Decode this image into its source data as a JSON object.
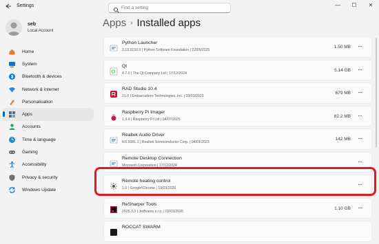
{
  "window": {
    "title": "Settings",
    "controls": [
      "—",
      "☐",
      "✕"
    ]
  },
  "search": {
    "placeholder": "Find a setting"
  },
  "user": {
    "name": "seb",
    "account_type": "Local Account"
  },
  "sidebar": {
    "items": [
      {
        "label": "Home",
        "icon": "home-icon",
        "color": "#e07c36"
      },
      {
        "label": "System",
        "icon": "system-icon",
        "color": "#0a78d4"
      },
      {
        "label": "Bluetooth & devices",
        "icon": "bluetooth-icon",
        "color": "#0a78d4"
      },
      {
        "label": "Network & internet",
        "icon": "network-icon",
        "color": "#3a86d4"
      },
      {
        "label": "Personalisation",
        "icon": "personalisation-icon",
        "color": "#e08b3a"
      },
      {
        "label": "Apps",
        "icon": "apps-icon",
        "color": "#4b6b8f",
        "active": true
      },
      {
        "label": "Accounts",
        "icon": "accounts-icon",
        "color": "#2f9e6a"
      },
      {
        "label": "Time & language",
        "icon": "time-language-icon",
        "color": "#2a83d4"
      },
      {
        "label": "Gaming",
        "icon": "gaming-icon",
        "color": "#6b6b6b"
      },
      {
        "label": "Accessibility",
        "icon": "accessibility-icon",
        "color": "#1c78c8"
      },
      {
        "label": "Privacy & security",
        "icon": "privacy-security-icon",
        "color": "#707070"
      },
      {
        "label": "Windows Update",
        "icon": "windows-update-icon",
        "color": "#0a78d4"
      }
    ]
  },
  "breadcrumb": {
    "parent": "Apps",
    "separator": "›",
    "current": "Installed apps"
  },
  "apps": [
    {
      "name": "Python Launcher",
      "version": "3.13.3150.0",
      "publisher": "Python Software Foundation",
      "date": "22/05/2025",
      "size": "1.50 MB",
      "icon": "python-icon"
    },
    {
      "name": "Qt",
      "version": "4.7.0",
      "publisher": "The Qt Company Ltd",
      "date": "17/12/2024",
      "size": "5.14 GB",
      "icon": "qt-icon"
    },
    {
      "name": "RAD Studio 10.4",
      "version": "21.0",
      "publisher": "Embarcadero Technologies, Inc.",
      "date": "03/03/2023",
      "size": "679 MB",
      "icon": "rad-studio-icon"
    },
    {
      "name": "Raspberry Pi Imager",
      "version": "1.9.4",
      "publisher": "Raspberry Pi Ltd",
      "date": "04/07/2025",
      "size": "82.2 MB",
      "icon": "raspberry-pi-icon"
    },
    {
      "name": "Realtek Audio Driver",
      "version": "6.0.9381.1",
      "publisher": "Realtek Semiconductor Corp.",
      "date": "04/01/2023",
      "size": "142 MB",
      "icon": "realtek-icon"
    },
    {
      "name": "Remote Desktop Connection",
      "version": "",
      "publisher": "Microsoft Corporation",
      "date": "17/12/2024",
      "size": "",
      "icon": "remote-desktop-icon",
      "meta_override": "Microsoft Corporation  |  17/12/2024"
    },
    {
      "name": "Remote heating control",
      "version": "1.0",
      "publisher": "Google\\Chrome",
      "date": "19/03/2026",
      "size": "",
      "icon": "remote-heating-icon"
    },
    {
      "name": "ReSharper Tools",
      "version": "2025.3.3",
      "publisher": "JetBrains s.r.o.",
      "date": "02/03/2026",
      "size": "1.10 GB",
      "icon": "resharper-icon"
    },
    {
      "name": "ROCCAT SWARM",
      "version": "",
      "publisher": "",
      "date": "",
      "size": "",
      "icon": "roccat-icon"
    }
  ],
  "more_label": "···",
  "accent": "#0067c0",
  "highlight_color": "#e3181f"
}
